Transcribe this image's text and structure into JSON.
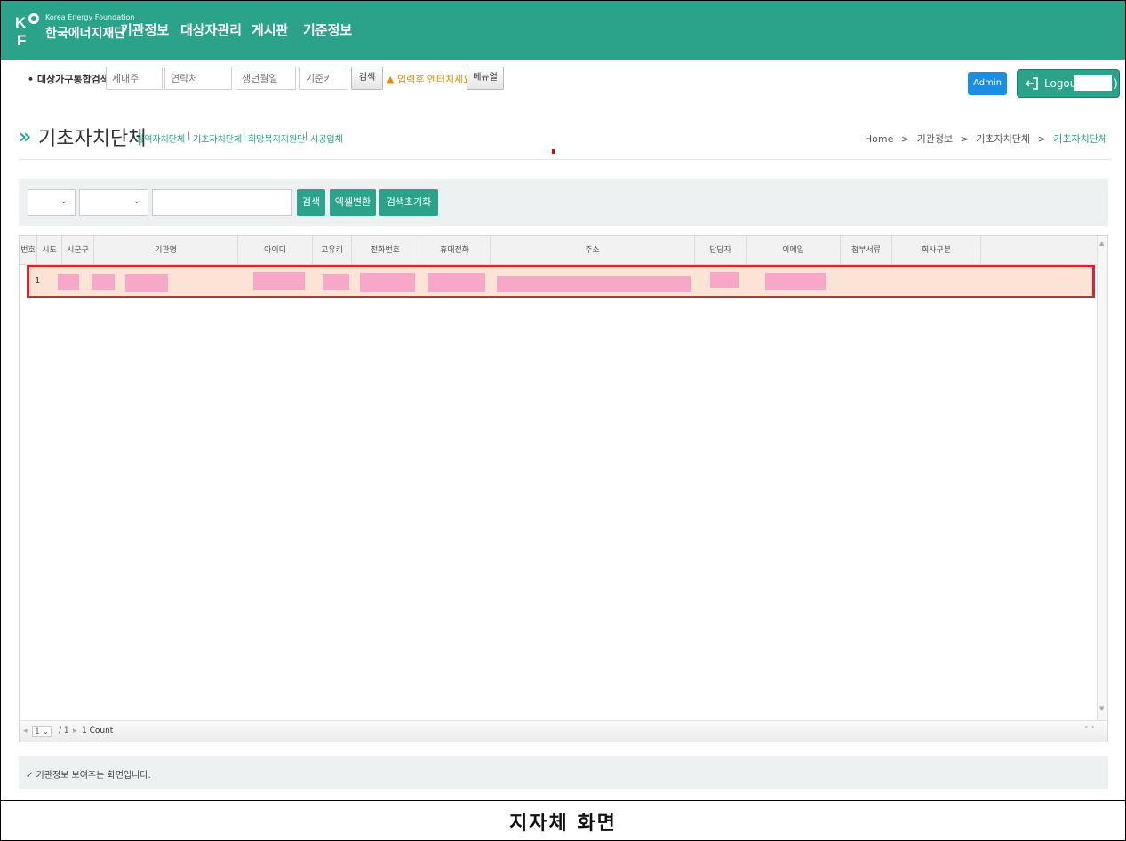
{
  "brand": {
    "name_en": "Korea Energy Foundation",
    "name_ko": "한국에너지재단",
    "color": "#2aa38a"
  },
  "nav": {
    "items": [
      "기관정보",
      "대상자관리",
      "게시판",
      "기준정보"
    ]
  },
  "search": {
    "label": "• 대상가구통합검색 :",
    "fields": [
      "세대주",
      "연락처",
      "생년월일",
      "기준키"
    ],
    "search_btn": "검색",
    "hint": "▲ 입력후 엔터치세요",
    "menu_btn": "메뉴얼"
  },
  "user": {
    "admin_label": "Admin",
    "logout_label": "Logout(",
    "logout_close": ")"
  },
  "page": {
    "title": "기초자치단체",
    "sublinks": [
      "광역자치단체",
      "기초자치단체",
      "희망복지지원단",
      "시공업체"
    ],
    "breadcrumb": [
      "Home",
      "기관정보",
      "기초자치단체",
      "기초자치단체"
    ],
    "breadcrumb_sep": ">"
  },
  "filters": {
    "select1_value": "",
    "select2_value": "",
    "text_value": "",
    "search_btn": "검색",
    "excel_btn": "엑셀변환",
    "reset_btn": "검색초기화"
  },
  "grid": {
    "columns": [
      "번호",
      "시도",
      "시군구",
      "기관명",
      "아이디",
      "고유키",
      "전화번호",
      "휴대전화",
      "주소",
      "담당자",
      "이메일",
      "첨부서류",
      "회사구분"
    ],
    "rows": [
      {
        "no": "1"
      }
    ],
    "pager": {
      "page": "1",
      "of": "/ 1",
      "count": "1 Count"
    }
  },
  "note": "✓ 기관정보 보여주는 화면입니다.",
  "caption": "지자체 화면",
  "colors": {
    "accent": "#2aa38a",
    "admin": "#1d8de1",
    "highlight_border": "#e0202f",
    "highlight_fill": "#fbe3d6",
    "redaction": "#f7a8c8"
  }
}
